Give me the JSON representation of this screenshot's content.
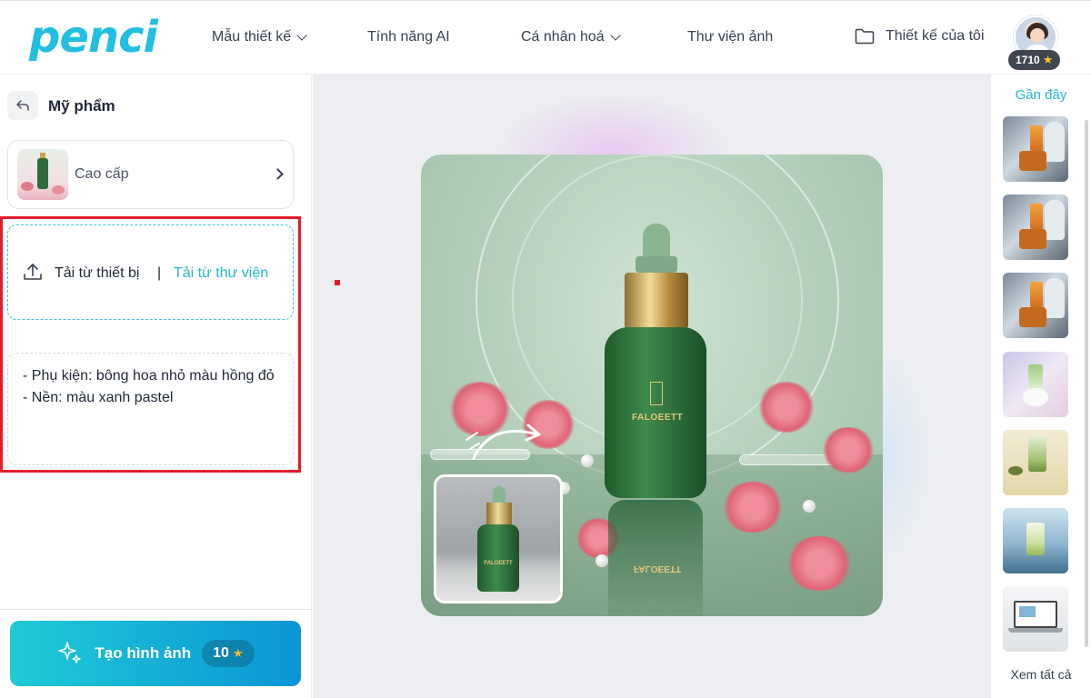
{
  "header": {
    "logo": "penci",
    "nav": [
      {
        "label": "Mẫu thiết kế",
        "has_dropdown": true
      },
      {
        "label": "Tính năng AI",
        "has_dropdown": false
      },
      {
        "label": "Cá nhân hoá",
        "has_dropdown": true
      },
      {
        "label": "Thư viện ảnh",
        "has_dropdown": false
      }
    ],
    "my_designs": "Thiết kế của tôi",
    "points": "1710"
  },
  "sidebar": {
    "category": "Mỹ phẩm",
    "style_label": "Cao cấp",
    "upload_device": "Tải từ thiết bị",
    "upload_separator": "|",
    "upload_library": "Tải từ thư viện",
    "prompt": "- Phụ kiện: bông hoa nhỏ màu hồng đỏ\n- Nền: màu xanh pastel",
    "generate_label": "Tạo hình ảnh",
    "generate_cost": "10"
  },
  "canvas": {
    "product_label": "FALOEETT"
  },
  "rail": {
    "title": "Gần đây",
    "see_all": "Xem tất cả",
    "thumbnails": [
      "robot-drink",
      "robot-drink",
      "robot-drink",
      "flower-drink",
      "matcha-drink",
      "sea-drink",
      "laptop-mockup"
    ]
  },
  "colors": {
    "accent": "#22bfe0",
    "highlight": "#e11d2a",
    "button_gradient_start": "#1fcad6",
    "button_gradient_end": "#0b95d6"
  },
  "icons": {
    "back": "back-arrow-icon",
    "upload": "upload-icon",
    "folder": "folder-icon",
    "sparkle": "sparkle-icon",
    "star": "star-icon"
  }
}
